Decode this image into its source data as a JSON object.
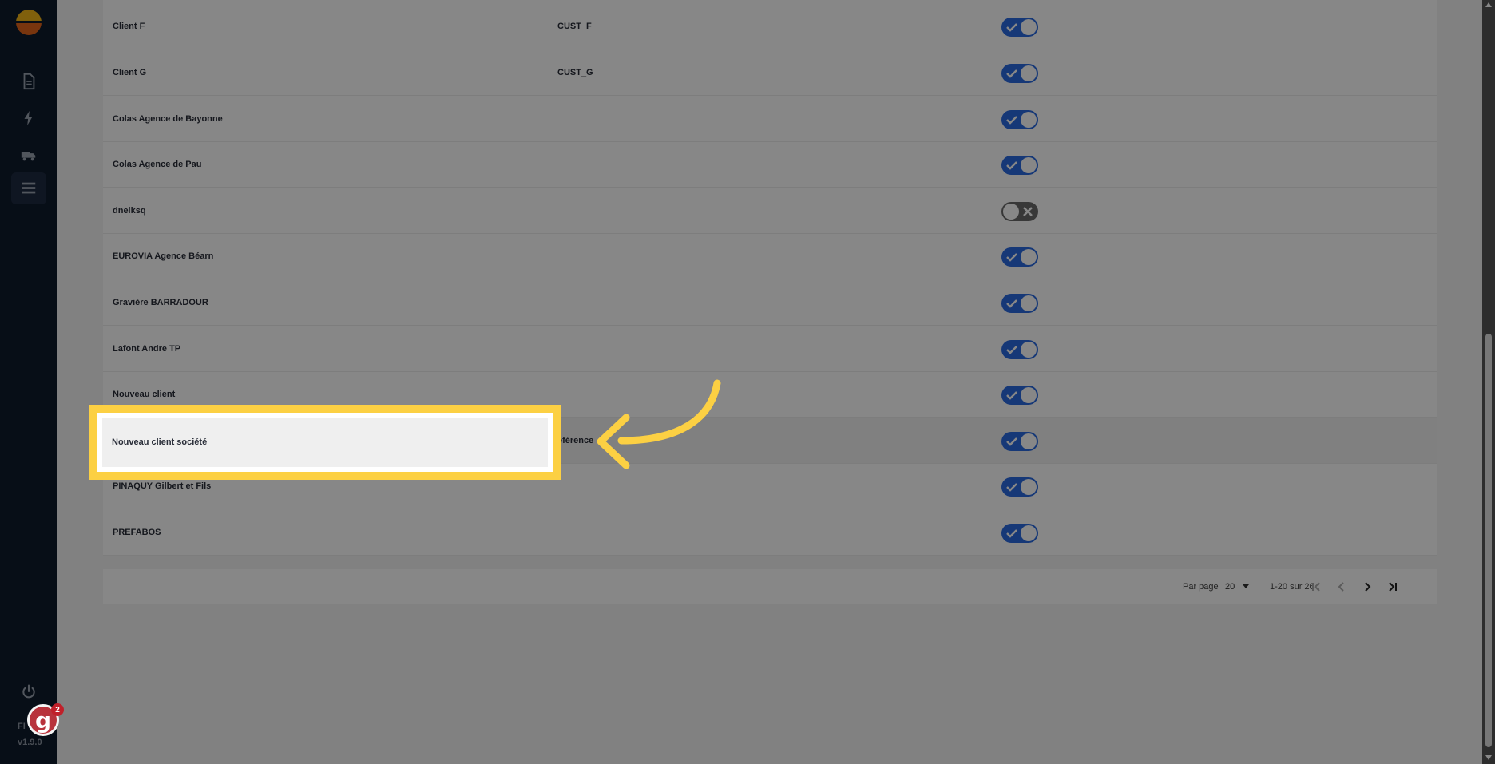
{
  "sidebar": {
    "logo": "sun-logo",
    "nav": [
      {
        "icon": "document-icon"
      },
      {
        "icon": "lightning-icon"
      },
      {
        "icon": "truck-icon"
      },
      {
        "icon": "list-icon",
        "active": true
      }
    ],
    "power_icon": "power-icon",
    "guide_badge": "g",
    "guide_count": "2",
    "app_name": "FI",
    "app_version": "v1.9.0"
  },
  "clients": [
    {
      "name": "Client F",
      "code": "CUST_F",
      "active": true
    },
    {
      "name": "Client G",
      "code": "CUST_G",
      "active": true
    },
    {
      "name": "Colas Agence de Bayonne",
      "code": "",
      "active": true
    },
    {
      "name": "Colas Agence de Pau",
      "code": "",
      "active": true
    },
    {
      "name": "dnelksq",
      "code": "",
      "active": false
    },
    {
      "name": "EUROVIA Agence Béarn",
      "code": "",
      "active": true
    },
    {
      "name": "Gravière BARRADOUR",
      "code": "",
      "active": true
    },
    {
      "name": "Lafont Andre TP",
      "code": "",
      "active": true
    },
    {
      "name": "Nouveau client",
      "code": "",
      "active": true
    },
    {
      "name": "Nouveau client société",
      "code": "éférence",
      "active": true,
      "highlighted": true
    },
    {
      "name": "PINAQUY Gilbert et Fils",
      "code": "",
      "active": true
    },
    {
      "name": "PREFABOS",
      "code": "",
      "active": true
    }
  ],
  "pagination": {
    "per_page_label": "Par page",
    "per_page_value": "20",
    "range": "1-20 sur 26"
  },
  "colors": {
    "sidebar": "#0f1b2d",
    "toggle_on": "#2a6be0",
    "toggle_off": "#6b6b6b",
    "highlight": "#fcd043"
  }
}
